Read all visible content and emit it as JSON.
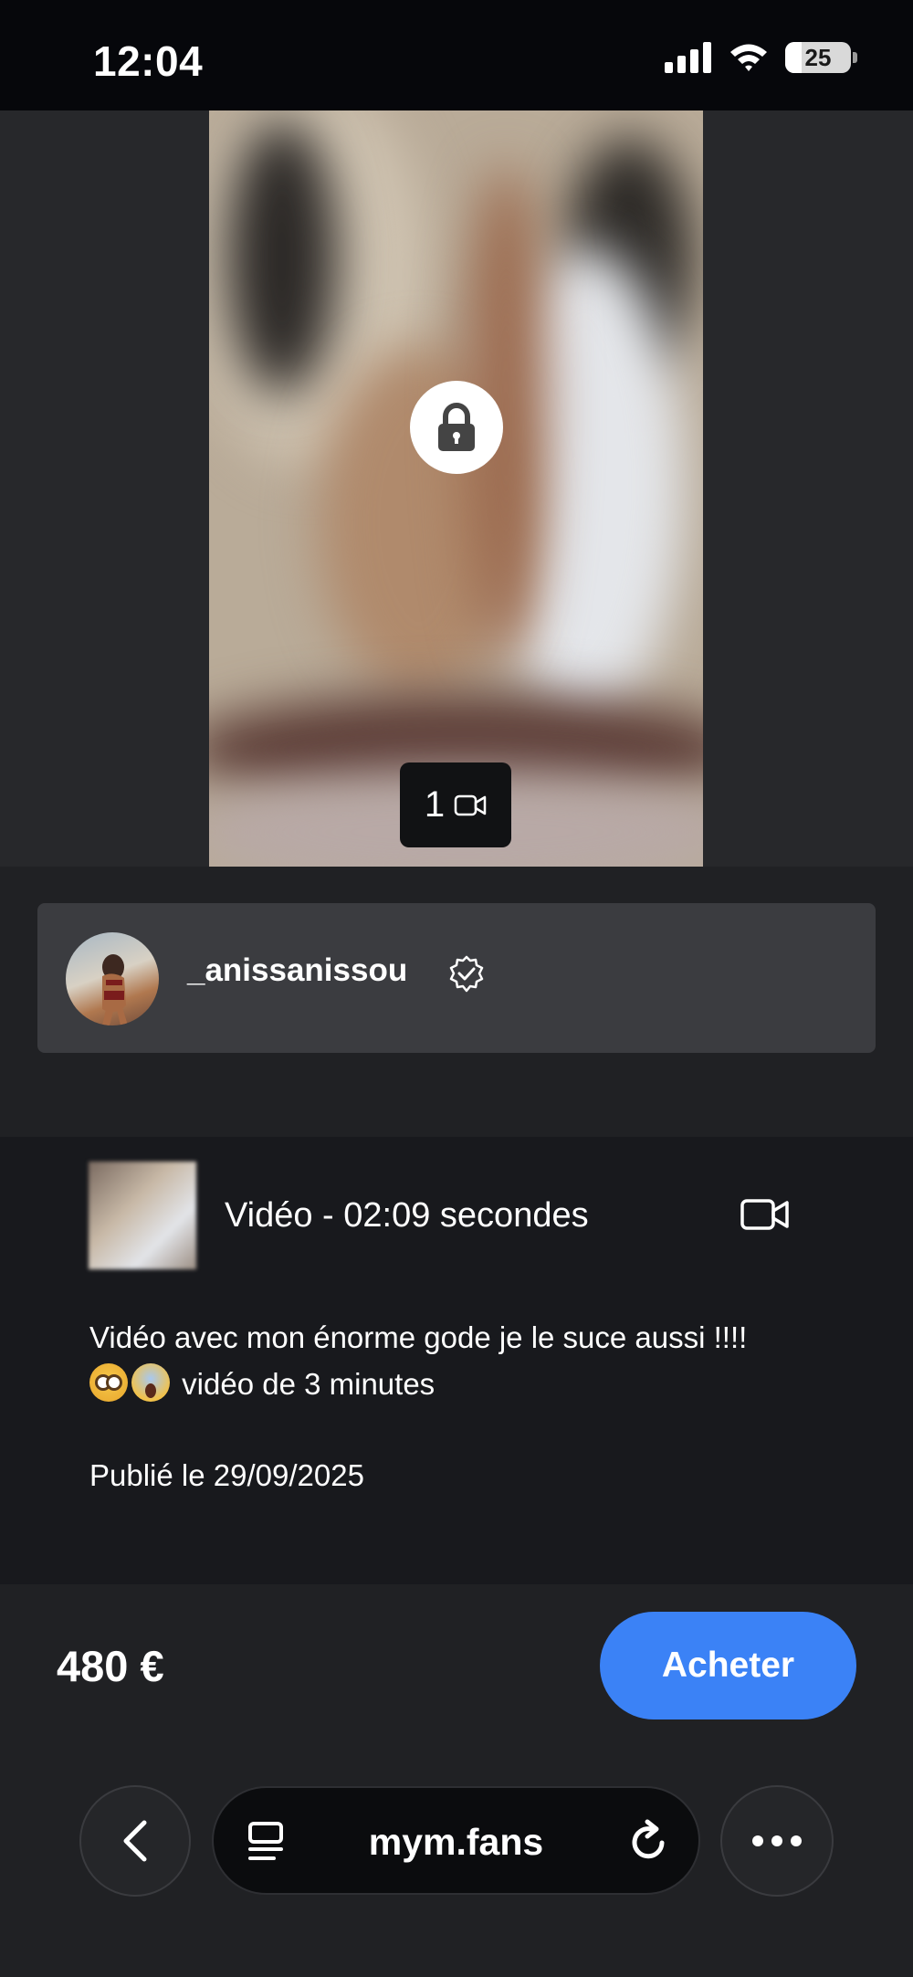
{
  "status_bar": {
    "time": "12:04",
    "battery": "25"
  },
  "media": {
    "count": "1"
  },
  "creator": {
    "username": "_anissanissou"
  },
  "post": {
    "video_info": "Vidéo - 02:09 secondes",
    "description_line1": "Vidéo avec mon énorme gode je le suce aussi !!!!",
    "description_line2": "vidéo de 3 minutes",
    "emojis": [
      "flushed-face",
      "face-screaming-in-fear"
    ],
    "published": "Publié le 29/09/2025"
  },
  "purchase": {
    "price": "480 €",
    "buy_label": "Acheter"
  },
  "browser": {
    "url": "mym.fans"
  },
  "colors": {
    "accent": "#3b82f6",
    "background": "#18191d",
    "card": "#3b3c40"
  }
}
